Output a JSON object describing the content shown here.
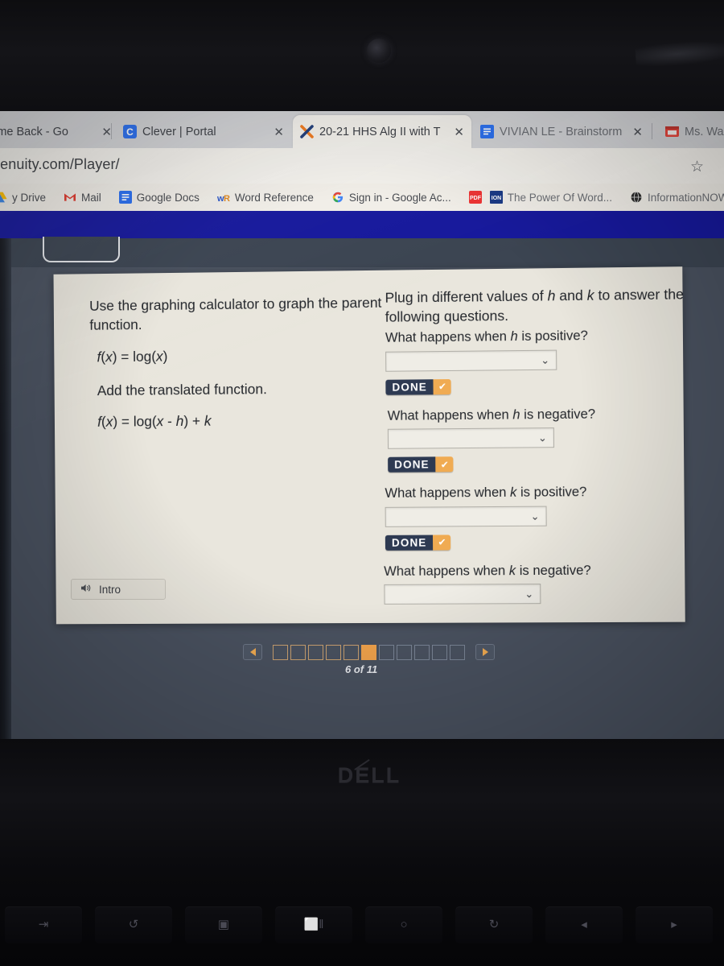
{
  "browser": {
    "tabs": [
      {
        "label": "t Time Back - Go",
        "icon": "generic-page-icon",
        "close": "✕",
        "active": false
      },
      {
        "label": "Clever | Portal",
        "icon": "clever-icon",
        "close": "✕",
        "active": false
      },
      {
        "label": "20-21 HHS Alg II with T",
        "icon": "imagine-learning-icon",
        "close": "✕",
        "active": true
      },
      {
        "label": "VIVIAN LE - Brainstorm",
        "icon": "google-docs-icon",
        "close": "✕",
        "active": false
      },
      {
        "label": "Ms. Wa",
        "icon": "calendar-icon",
        "close": "",
        "active": false
      }
    ],
    "url": "genuity.com/Player/",
    "star_icon": "☆",
    "bookmarks": [
      {
        "label": "y Drive",
        "icon": "google-drive-icon"
      },
      {
        "label": "Mail",
        "icon": "gmail-icon"
      },
      {
        "label": "Google Docs",
        "icon": "google-docs-icon"
      },
      {
        "label": "Word Reference",
        "icon": "word-reference-icon"
      },
      {
        "label": "Sign in - Google Ac...",
        "icon": "google-g-icon"
      },
      {
        "label": "",
        "icon": "pdf-icon"
      },
      {
        "label": "The Power Of Word...",
        "icon": "ion-icon"
      },
      {
        "label": "InformationNOW",
        "icon": "globe-icon"
      }
    ]
  },
  "lesson": {
    "left": {
      "instruction": "Use the graphing calculator to graph the parent function.",
      "parent_function": "f(x) = log(x)",
      "subinstruction": "Add the translated function.",
      "translated_function": "f(x) = log(x - h) + k"
    },
    "right": {
      "intro": "Plug in different values of h and k to answer the following questions.",
      "questions": [
        {
          "prompt": "What happens when h is positive?",
          "value": "",
          "chevron": "⌄",
          "done_label": "DONE",
          "done_check": "✔"
        },
        {
          "prompt": "What happens when h is negative?",
          "value": "",
          "chevron": "⌄",
          "done_label": "DONE",
          "done_check": "✔"
        },
        {
          "prompt": "What happens when k is positive?",
          "value": "",
          "chevron": "⌄",
          "done_label": "DONE",
          "done_check": "✔"
        },
        {
          "prompt": "What happens when k is negative?",
          "value": "",
          "chevron": "⌄",
          "done_label": "",
          "done_check": ""
        }
      ]
    },
    "intro_button": {
      "label": "Intro",
      "icon": "speaker-icon"
    },
    "pager": {
      "prev_icon": "◀",
      "next_icon": "▶",
      "total": 11,
      "current": 6,
      "counter": "6 of 11"
    }
  },
  "shelf": {
    "icons": [
      {
        "name": "google-docs-shelf-icon"
      },
      {
        "name": "gmail-shelf-icon"
      },
      {
        "name": "chrome-shelf-icon"
      },
      {
        "name": "youtube-shelf-icon"
      },
      {
        "name": "play-store-shelf-icon"
      },
      {
        "name": "teal-app-shelf-icon"
      }
    ]
  },
  "device": {
    "brand": "D",
    "brand_mid": "E",
    "brand_tail": "LL",
    "keys": [
      "⇥",
      "↺",
      "▣",
      "⬜‖",
      "○",
      "↻",
      "◂",
      "▸"
    ]
  },
  "colors": {
    "blue_bar": "#17199c",
    "player_bg": "#4a5260",
    "card_bg": "#e9e6dd",
    "done_navy": "#2e3a52",
    "accent_orange": "#f0ab52"
  }
}
